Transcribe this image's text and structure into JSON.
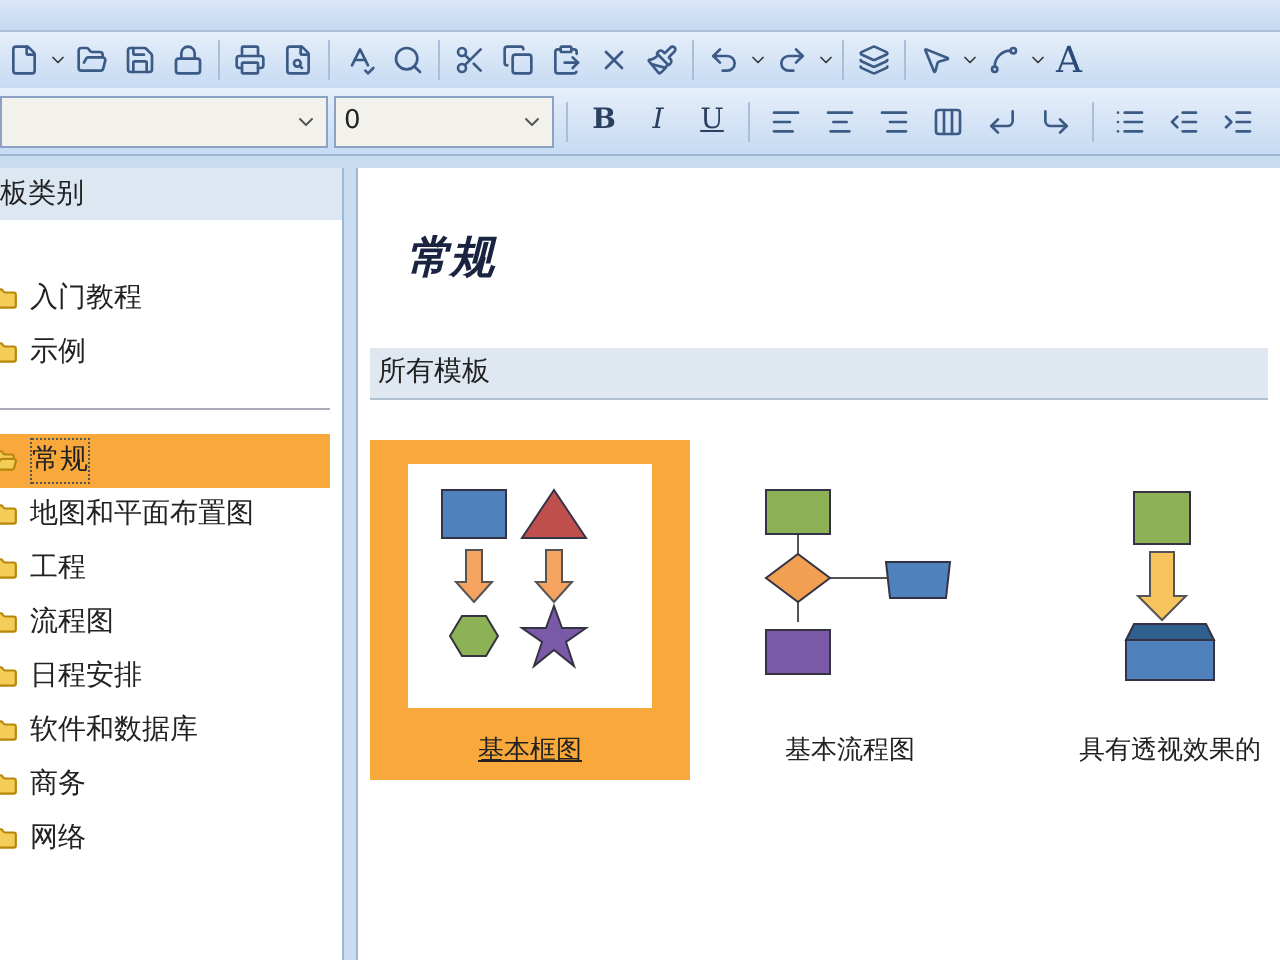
{
  "toolbar": {
    "text_tool": "A"
  },
  "format_bar": {
    "size_field": {
      "value": "0"
    },
    "bold": "B",
    "italic": "I",
    "underline": "U"
  },
  "category_panel": {
    "title": "板类别",
    "groups": [
      {
        "items": [
          {
            "label": "入门教程",
            "selected": false
          },
          {
            "label": "示例",
            "selected": false
          }
        ]
      },
      {
        "items": [
          {
            "label": "常规",
            "selected": true
          },
          {
            "label": "地图和平面布置图",
            "selected": false
          },
          {
            "label": "工程",
            "selected": false
          },
          {
            "label": "流程图",
            "selected": false
          },
          {
            "label": "日程安排",
            "selected": false
          },
          {
            "label": "软件和数据库",
            "selected": false
          },
          {
            "label": "商务",
            "selected": false
          },
          {
            "label": "网络",
            "selected": false
          }
        ]
      }
    ]
  },
  "content": {
    "heading": "常规",
    "section_title": "所有模板",
    "templates": [
      {
        "kind": "block",
        "label": "基本框图",
        "selected": true
      },
      {
        "kind": "flowchart",
        "label": "基本流程图",
        "selected": false
      },
      {
        "kind": "perspective",
        "label": "具有透视效果的",
        "selected": false
      }
    ]
  }
}
